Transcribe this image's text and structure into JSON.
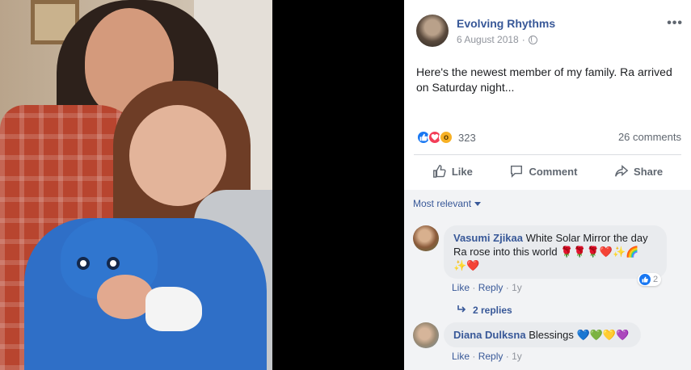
{
  "post": {
    "author": "Evolving Rhythms",
    "date": "6 August 2018",
    "more_glyph": "•••",
    "text_line1": "Here's the newest member of my family. Ra arrived",
    "text_line2": "on Saturday night..."
  },
  "reactions": {
    "count": "323",
    "types": [
      "like-icon",
      "love-icon",
      "wow-icon"
    ],
    "comments": "26 comments"
  },
  "actions": {
    "like": "Like",
    "comment": "Comment",
    "share": "Share"
  },
  "comments_section": {
    "sort_label": "Most relevant",
    "comments": [
      {
        "author": "Vasumi Zjikaa",
        "text_line1": " White Solar Mirror the day",
        "text_line2": "Ra rose into this world 🌹🌹🌹❤️✨🌈",
        "text_line3": "✨❤️",
        "like": "Like",
        "reply": "Reply",
        "time": "1y",
        "like_count": "2",
        "replies": "2 replies"
      },
      {
        "author": "Diana Dulksna",
        "text": " Blessings 💙💚💛💜",
        "like": "Like",
        "reply": "Reply",
        "time": "1y"
      }
    ]
  },
  "colors": {
    "link_blue": "#385898",
    "like_blue": "#1877f2",
    "love_red": "#f33e58",
    "wow_yellow": "#f7b125"
  }
}
